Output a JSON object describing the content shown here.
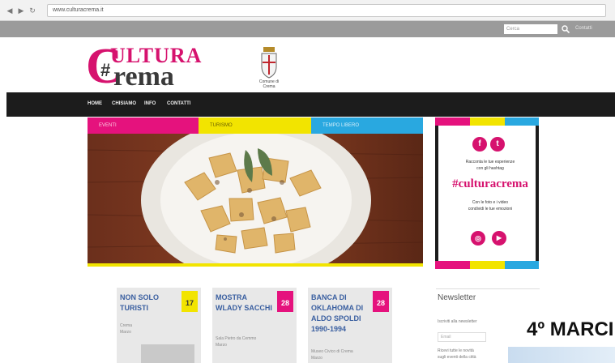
{
  "browser": {
    "back": "◀",
    "forward": "▶",
    "reload": "↻",
    "url": "www.culturacrema.it"
  },
  "topbar": {
    "search_placeholder": "Cerca",
    "link": "Contatti"
  },
  "logo": {
    "top": "ULTURA",
    "bottom": "rema",
    "c": "C",
    "hash": "#"
  },
  "crest": {
    "caption": "Comune di Crema"
  },
  "nav": [
    "HOME",
    "CHISIAMO",
    "INFO",
    "CONTATTI"
  ],
  "categories": [
    {
      "label": "EVENTI",
      "color": "#e5127d"
    },
    {
      "label": "TURISMO",
      "color": "#f2e400"
    },
    {
      "label": "TEMPO LIBERO",
      "color": "#29a8e0"
    }
  ],
  "sidebar": {
    "facebook": "f",
    "twitter": "t",
    "line1": "Racconta le tue esperienze",
    "line2": "con gli hashtag",
    "hashtag": "#culturacrema",
    "line3": "Con le foto e i video",
    "line4": "condividi le tue emozioni",
    "instagram": "◎",
    "youtube": "▶"
  },
  "cards": [
    {
      "title": "NON SOLO TURISTI",
      "date": "17",
      "date_color": "#f2e400",
      "meta1": "Crema",
      "meta2": "Marzo"
    },
    {
      "title": "MOSTRA WLADY SACCHI",
      "date": "28",
      "date_color": "#e5127d",
      "meta1": "Sala Pietro da Cemmo",
      "meta2": "Marzo"
    },
    {
      "title": "BANCA DI OKLAHOMA di Aldo Spoldi 1990-1994",
      "date": "28",
      "date_color": "#e5127d",
      "meta1": "Museo Civico di Crema",
      "meta2": "Marzo"
    }
  ],
  "newsletter": {
    "title": "Newsletter",
    "line1": "Iscriviti alla newsletter",
    "input_placeholder": "Email",
    "line2": "Ricevi tutte le novità",
    "line3": "sugli eventi della città"
  },
  "overlay": {
    "text": "4º MARCI"
  }
}
